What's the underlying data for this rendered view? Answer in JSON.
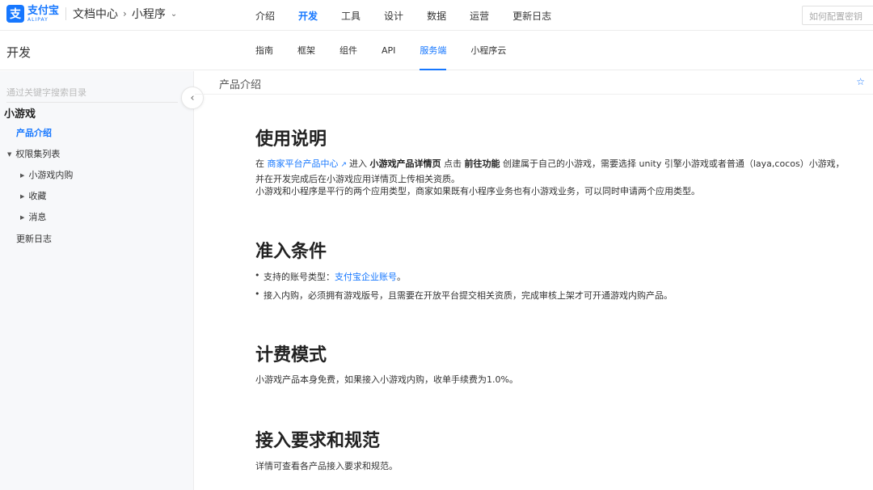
{
  "header": {
    "logo_mark": "支",
    "logo_cn": "支付宝",
    "logo_en": "ALIPAY",
    "breadcrumb_1": "文档中心",
    "breadcrumb_sep": "›",
    "breadcrumb_2": "小程序",
    "breadcrumb_chevron": "⌄",
    "nav": [
      "介绍",
      "开发",
      "工具",
      "设计",
      "数据",
      "运营",
      "更新日志"
    ],
    "nav_active": "开发",
    "search_placeholder": "如何配置密钥"
  },
  "subheader": {
    "section_title": "开发",
    "tabs": [
      "指南",
      "框架",
      "组件",
      "API",
      "服务端",
      "小程序云"
    ],
    "tab_active": "服务端"
  },
  "sidebar": {
    "search_placeholder": "通过关键字搜索目录",
    "group_title": "小游戏",
    "item_intro": "产品介绍",
    "item_permissions": "权限集列表",
    "item_iap": "小游戏内购",
    "item_collect": "收藏",
    "item_message": "消息",
    "item_changelog": "更新日志",
    "collapse_glyph": "‹"
  },
  "main": {
    "page_title": "产品介绍",
    "star_glyph": "☆",
    "s1": {
      "title": "使用说明",
      "p1_prefix": "在 ",
      "p1_link": "商家平台产品中心",
      "p1_link_icon": "↗",
      "p1_mid1": "进入 ",
      "p1_bold1": "小游戏产品详情页",
      "p1_mid2": " 点击 ",
      "p1_bold2": "前往功能",
      "p1_rest": " 创建属于自己的小游戏，需要选择 unity 引擎小游戏或者普通（laya,cocos）小游戏，并在开发完成后在小游戏应用详情页上传相关资质。",
      "p2": "小游戏和小程序是平行的两个应用类型，商家如果既有小程序业务也有小游戏业务，可以同时申请两个应用类型。"
    },
    "s2": {
      "title": "准入条件",
      "b1_prefix": "支持的账号类型：",
      "b1_link": "支付宝企业账号",
      "b1_suffix": "。",
      "b2": "接入内购，必须拥有游戏版号，且需要在开放平台提交相关资质，完成审核上架才可开通游戏内购产品。"
    },
    "s3": {
      "title": "计费模式",
      "p1": "小游戏产品本身免费，如果接入小游戏内购，收单手续费为1.0%。"
    },
    "s4": {
      "title": "接入要求和规范",
      "p1": "详情可查看各产品接入要求和规范。"
    }
  }
}
